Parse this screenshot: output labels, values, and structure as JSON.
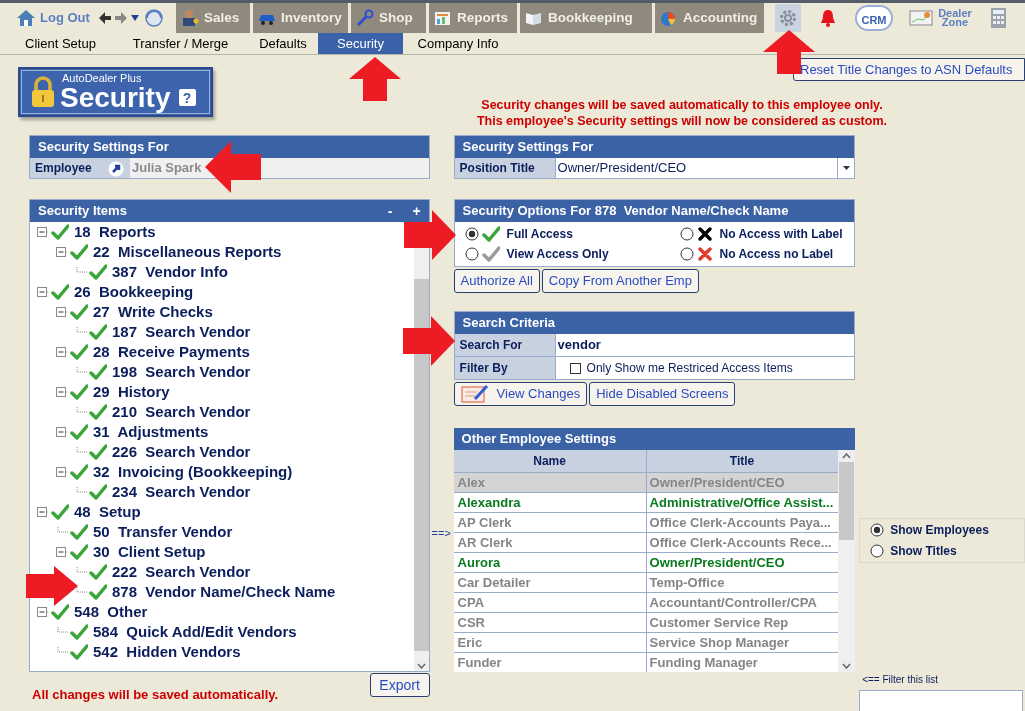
{
  "nav": {
    "logout": "Log Out",
    "modules": [
      "Sales",
      "Inventory",
      "Shop",
      "Reports",
      "Bookkeeping",
      "Accounting"
    ],
    "tools": [
      {
        "kind": "gear",
        "selected": true
      },
      {
        "kind": "bell",
        "selected": false
      },
      {
        "kind": "crm",
        "label": "CRM",
        "selected": false
      },
      {
        "kind": "zone",
        "label": "Dealer Zone",
        "selected": false
      },
      {
        "kind": "calculator",
        "selected": false
      }
    ]
  },
  "subtabs": [
    {
      "label": "Client Setup",
      "selected": false
    },
    {
      "label": "Transfer / Merge",
      "selected": false
    },
    {
      "label": "Defaults",
      "selected": false
    },
    {
      "label": "Security",
      "selected": true
    },
    {
      "label": "Company Info",
      "selected": false
    }
  ],
  "logo": {
    "brand": "AutoDealer Plus",
    "title": "Security",
    "help": "?"
  },
  "reset_button": "Reset Title Changes to ASN Defaults",
  "notice": [
    "Security changes will be saved automatically to this employee only.",
    "This employee's Security settings will now be considered as custom."
  ],
  "employee_panel": {
    "title": "Security Settings For",
    "label": "Employee",
    "value": "Julia Spark"
  },
  "position_panel": {
    "title": "Security Settings For",
    "label": "Position Title",
    "value": "Owner/President/CEO"
  },
  "security_items": {
    "title": "Security Items",
    "collapse": "-",
    "expand": "+",
    "tree": [
      {
        "text": "18  Reports",
        "kind": "full",
        "expanded": true,
        "children": [
          {
            "text": "22  Miscellaneous Reports",
            "kind": "full",
            "expanded": true,
            "children": [
              {
                "text": "387  Vendor Info",
                "kind": "full"
              }
            ]
          }
        ]
      },
      {
        "text": "26  Bookkeeping",
        "kind": "full",
        "expanded": true,
        "children": [
          {
            "text": "27  Write Checks",
            "kind": "full",
            "expanded": true,
            "children": [
              {
                "text": "187  Search Vendor",
                "kind": "full"
              }
            ]
          },
          {
            "text": "28  Receive Payments",
            "kind": "full",
            "expanded": true,
            "children": [
              {
                "text": "198  Search Vendor",
                "kind": "full"
              }
            ]
          },
          {
            "text": "29  History",
            "kind": "full",
            "expanded": true,
            "children": [
              {
                "text": "210  Search Vendor",
                "kind": "full"
              }
            ]
          },
          {
            "text": "31  Adjustments",
            "kind": "full",
            "expanded": true,
            "children": [
              {
                "text": "226  Search Vendor",
                "kind": "full"
              }
            ]
          },
          {
            "text": "32  Invoicing (Bookkeeping)",
            "kind": "full",
            "expanded": true,
            "children": [
              {
                "text": "234  Search Vendor",
                "kind": "full"
              }
            ]
          }
        ]
      },
      {
        "text": "48  Setup",
        "kind": "full",
        "expanded": true,
        "children": [
          {
            "text": "50  Transfer Vendor",
            "kind": "full"
          },
          {
            "text": "30  Client Setup",
            "kind": "full",
            "expanded": true,
            "children": [
              {
                "text": "222  Search Vendor",
                "kind": "full"
              },
              {
                "text": "878  Vendor Name/Check Name",
                "kind": "full"
              }
            ]
          }
        ]
      },
      {
        "text": "548  Other",
        "kind": "full",
        "expanded": true,
        "children": [
          {
            "text": "584  Quick Add/Edit Vendors",
            "kind": "full"
          },
          {
            "text": "542  Hidden Vendors",
            "kind": "full"
          }
        ]
      }
    ]
  },
  "footer_note": "All changes will be saved automatically.",
  "export_button": "Export",
  "link_arrow": "==>",
  "options": {
    "title": "Security Options For 878  Vendor Name/Check Name",
    "choices": [
      {
        "label": "Full Access",
        "kind": "full",
        "selected": true
      },
      {
        "label": "No Access with Label",
        "kind": "label",
        "selected": false
      },
      {
        "label": "View Access Only",
        "kind": "view",
        "selected": false
      },
      {
        "label": "No Access no Label",
        "kind": "none",
        "selected": false
      }
    ]
  },
  "option_buttons": [
    "Authorize All",
    "Copy From Another Emp"
  ],
  "search": {
    "title": "Search Criteria",
    "search_label": "Search For",
    "search_value": "vendor",
    "filter_label": "Filter By",
    "filter_option": {
      "label": "Only Show me Restriced Access Items",
      "checked": false
    }
  },
  "search_buttons": [
    "View Changes",
    "Hide Disabled Screens"
  ],
  "employees": {
    "title": "Other Employee Settings",
    "columns": [
      "Name",
      "Title"
    ],
    "rows": [
      {
        "name": "Alex",
        "title": "Owner/President/CEO",
        "custom": false,
        "selected": true
      },
      {
        "name": "Alexandra",
        "title": "Administrative/Office Assist...",
        "custom": true,
        "selected": false
      },
      {
        "name": "AP Clerk",
        "title": "Office Clerk-Accounts Paya...",
        "custom": false,
        "selected": false
      },
      {
        "name": "AR Clerk",
        "title": "Office Clerk-Accounts Rece...",
        "custom": false,
        "selected": false
      },
      {
        "name": "Aurora",
        "title": "Owner/President/CEO",
        "custom": true,
        "selected": false
      },
      {
        "name": "Car Detailer",
        "title": "Temp-Office",
        "custom": false,
        "selected": false
      },
      {
        "name": "CPA",
        "title": "Accountant/Controller/CPA",
        "custom": false,
        "selected": false
      },
      {
        "name": "CSR",
        "title": "Customer Service Rep",
        "custom": false,
        "selected": false
      },
      {
        "name": "Eric",
        "title": "Service Shop Manager",
        "custom": false,
        "selected": false
      },
      {
        "name": "Funder",
        "title": "Funding Manager",
        "custom": false,
        "selected": false
      }
    ]
  },
  "view_mode": [
    {
      "label": "Show Employees",
      "selected": true
    },
    {
      "label": "Show Titles",
      "selected": false
    }
  ],
  "filter": {
    "hint": "<== Filter this list"
  }
}
